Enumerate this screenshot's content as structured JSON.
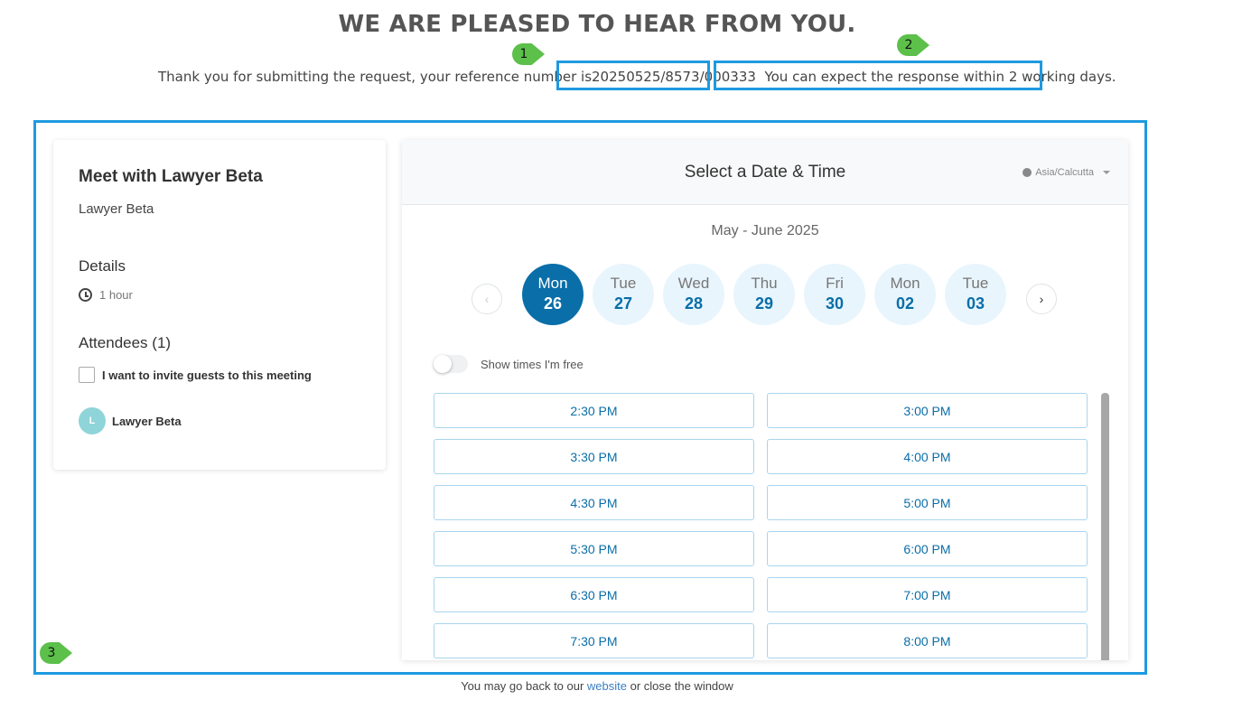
{
  "headline": "WE ARE PLEASED TO HEAR FROM YOU.",
  "confirmation": {
    "prefix": "Thank you for submitting the request, your reference number is ",
    "reference": "20250525/8573/000333",
    "response": "You can expect the response within 2 working days."
  },
  "markers": [
    "1",
    "2",
    "3"
  ],
  "event": {
    "title": "Meet with Lawyer Beta",
    "host": "Lawyer Beta",
    "details_heading": "Details",
    "duration": "1 hour",
    "attendees_heading": "Attendees (1)",
    "invite_label": "I want to invite guests to this meeting",
    "attendee": {
      "initial": "L",
      "name": "Lawyer Beta"
    }
  },
  "scheduler": {
    "title": "Select a Date & Time",
    "timezone": "Asia/Calcutta",
    "month_range": "May - June 2025",
    "prev_icon": "‹",
    "next_icon": "›",
    "days": [
      {
        "name": "Mon",
        "date": "26",
        "selected": true
      },
      {
        "name": "Tue",
        "date": "27"
      },
      {
        "name": "Wed",
        "date": "28"
      },
      {
        "name": "Thu",
        "date": "29"
      },
      {
        "name": "Fri",
        "date": "30"
      },
      {
        "name": "Mon",
        "date": "02"
      },
      {
        "name": "Tue",
        "date": "03"
      }
    ],
    "toggle_label": "Show times I'm free",
    "slots": [
      "2:30 PM",
      "3:00 PM",
      "3:30 PM",
      "4:00 PM",
      "4:30 PM",
      "5:00 PM",
      "5:30 PM",
      "6:00 PM",
      "6:30 PM",
      "7:00 PM",
      "7:30 PM",
      "8:00 PM"
    ]
  },
  "footer": {
    "prefix": "You may go back to our ",
    "link": "website",
    "suffix": " or close the window"
  },
  "colors": {
    "accent": "#0a6ea8",
    "annotation_box": "#1e9ae0",
    "marker": "#5cc04a"
  }
}
